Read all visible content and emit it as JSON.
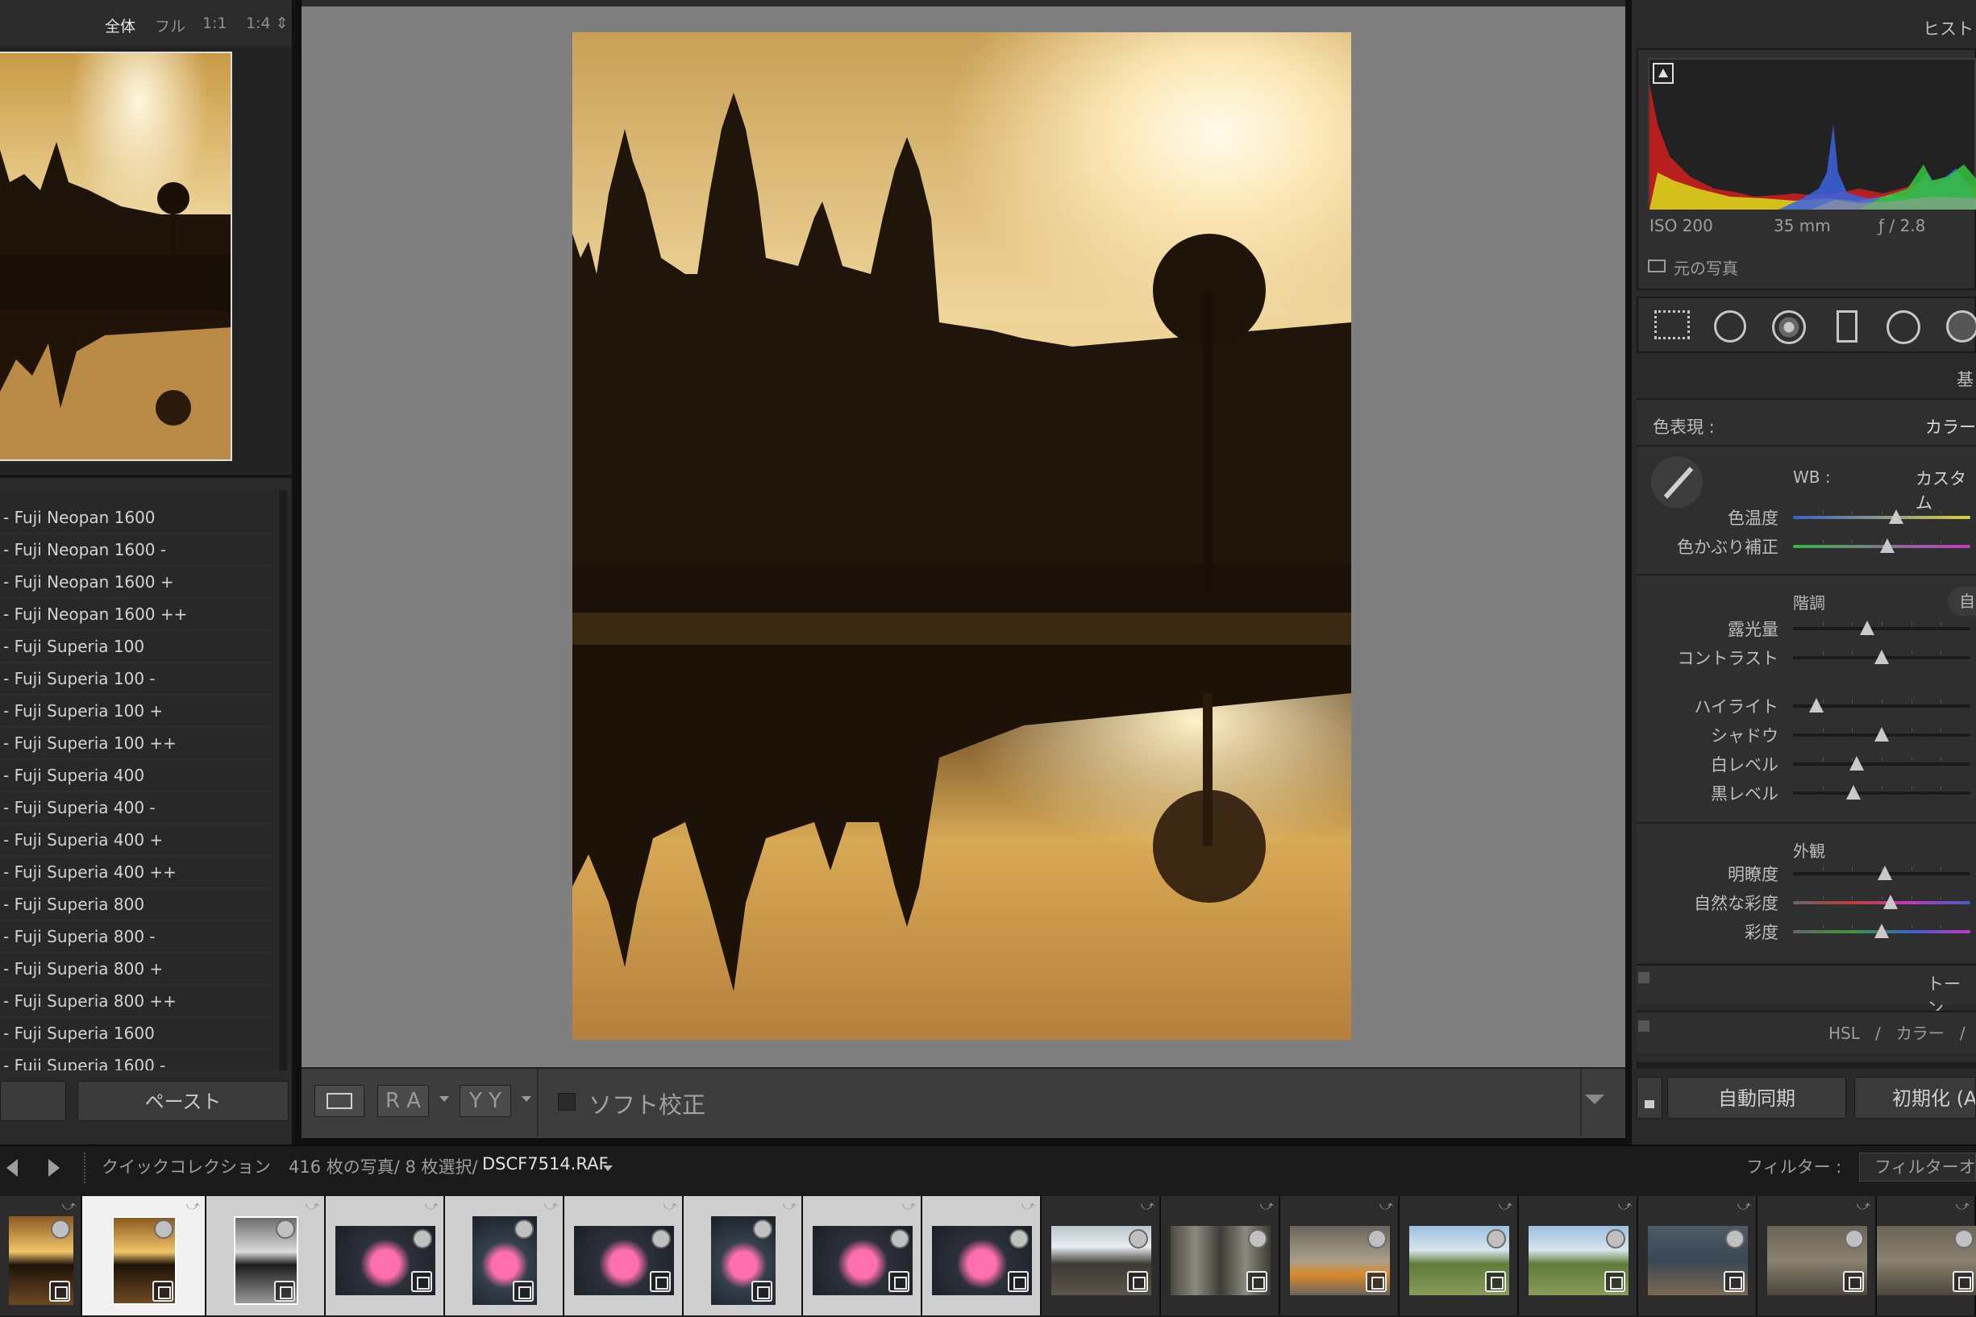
{
  "left_panel": {
    "zoom_options": [
      "全体",
      "フル",
      "1:1",
      "1:4 ⇕"
    ],
    "presets": [
      "- Fuji Neopan 1600",
      "- Fuji Neopan 1600 -",
      "- Fuji Neopan 1600 +",
      "- Fuji Neopan 1600 ++",
      "- Fuji Superia 100",
      "- Fuji Superia 100 -",
      "- Fuji Superia 100 +",
      "- Fuji Superia 100 ++",
      "- Fuji Superia 400",
      "- Fuji Superia 400 -",
      "- Fuji Superia 400 +",
      "- Fuji Superia 400 ++",
      "- Fuji Superia 800",
      "- Fuji Superia 800 -",
      "- Fuji Superia 800 +",
      "- Fuji Superia 800 ++",
      "- Fuji Superia 1600",
      "- Fuji Superia 1600 -"
    ],
    "paste_button": "ペースト"
  },
  "toolbar": {
    "view_ra": "R A",
    "view_yy": "Y Y",
    "soft_proof_label": "ソフト校正"
  },
  "right_panel": {
    "histogram_title": "ヒスト",
    "iso": "ISO 200",
    "focal": "35 mm",
    "aperture": "ƒ / 2.8",
    "original_photo": "元の写真",
    "basic_title": "基",
    "treatment_label": "色表現 :",
    "treatment_value": "カラー",
    "wb_label": "WB :",
    "wb_value": "カスタム",
    "temp_label": "色温度",
    "tint_label": "色かぶり補正",
    "tone_title": "階調",
    "tone_auto": "自",
    "exposure_label": "露光量",
    "contrast_label": "コントラスト",
    "highlights_label": "ハイライト",
    "shadows_label": "シャドウ",
    "whites_label": "白レベル",
    "blacks_label": "黒レベル",
    "presence_title": "外観",
    "clarity_label": "明瞭度",
    "vibrance_label": "自然な彩度",
    "saturation_label": "彩度",
    "tone_curve_title": "トーン",
    "hsl_title": "HSL   /   カラー   /",
    "sync_button": "自動同期",
    "reset_button": "初期化 (A"
  },
  "sliders": {
    "temp": 0.58,
    "tint": 0.53,
    "exposure": 0.42,
    "contrast": 0.5,
    "highlights": 0.13,
    "shadows": 0.5,
    "whites": 0.36,
    "blacks": 0.34,
    "clarity": 0.52,
    "vibrance": 0.55,
    "saturation": 0.5
  },
  "filmstrip_bar": {
    "source": "クイックコレクション",
    "count": "416 枚の写真/ 8 枚選択/",
    "filename": "DSCF7514.RAF",
    "filter_label": "フィルター :",
    "filter_value": "フィルターオ"
  }
}
